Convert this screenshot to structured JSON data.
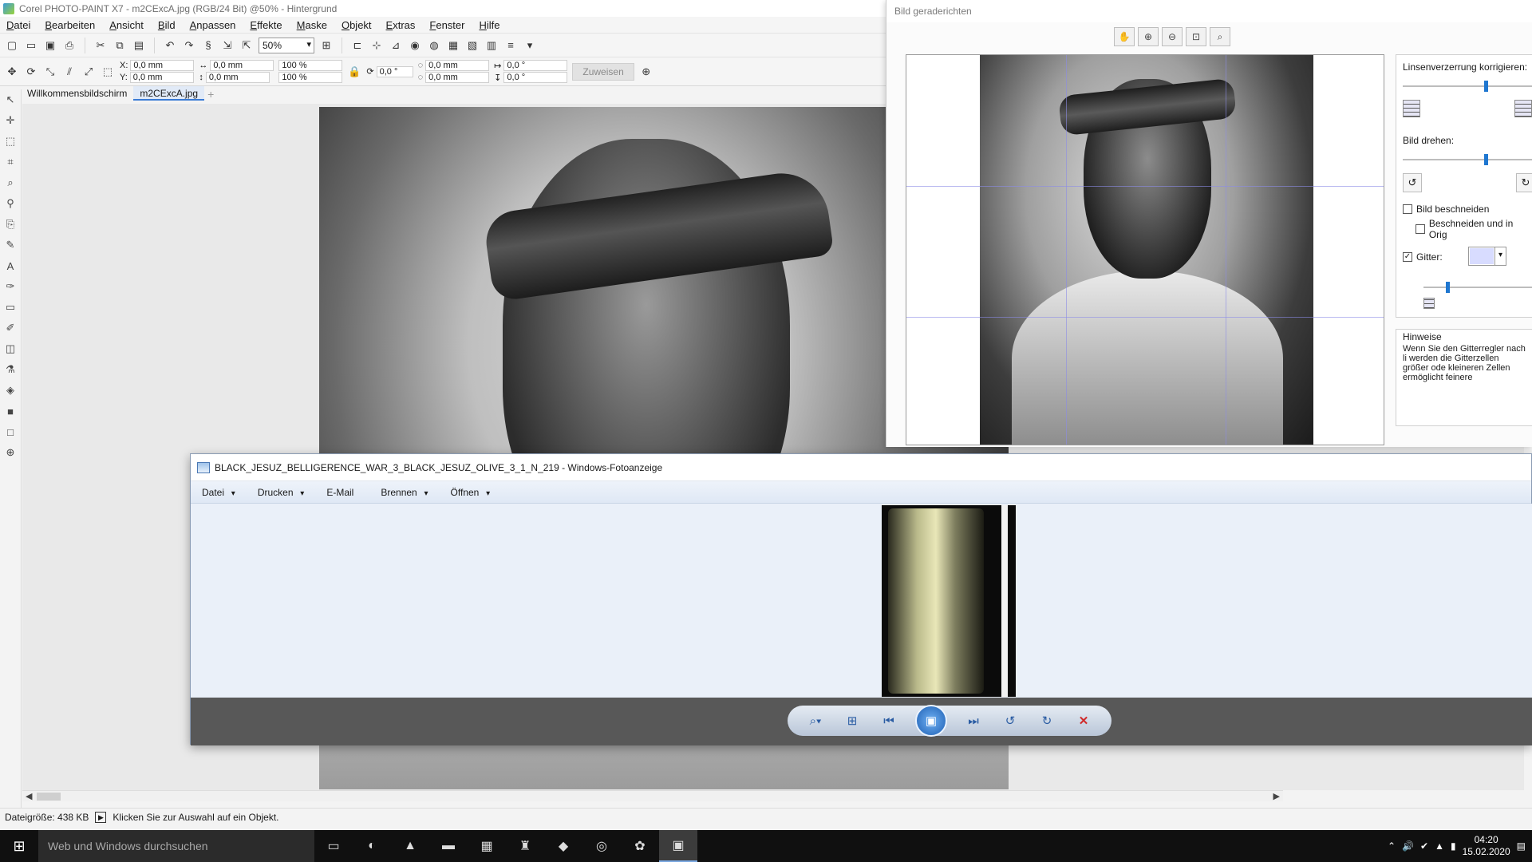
{
  "corel": {
    "title": "Corel PHOTO-PAINT X7 - m2CExcA.jpg (RGB/24 Bit) @50% - Hintergrund",
    "menu": [
      "Datei",
      "Bearbeiten",
      "Ansicht",
      "Bild",
      "Anpassen",
      "Effekte",
      "Maske",
      "Objekt",
      "Extras",
      "Fenster",
      "Hilfe"
    ],
    "zoom": "50%",
    "props": {
      "x": "0,0 mm",
      "y": "0,0 mm",
      "w": "0,0 mm",
      "h": "0,0 mm",
      "scale_w": "100 %",
      "scale_h": "100 %",
      "angle": "0,0 °",
      "pos1": "0,0 mm",
      "pos2": "0,0 mm",
      "skew1": "0,0 °",
      "skew2": "0,0 °",
      "assign": "Zuweisen"
    },
    "tabs": [
      "Willkommensbildschirm",
      "m2CExcA.jpg"
    ],
    "status": {
      "filesize": "Dateigröße: 438 KB",
      "hint": "Klicken Sie zur Auswahl auf ein Objekt."
    }
  },
  "straighten": {
    "title": "Bild geraderichten",
    "lens_label": "Linsenverzerrung korrigieren:",
    "rotate_label": "Bild drehen:",
    "crop_label": "Bild beschneiden",
    "crop_orig_label": "Beschneiden und in Orig",
    "grid_label": "Gitter:",
    "grid_color": "#d8dcff",
    "grid_checked": true,
    "crop_checked": false,
    "lens_value": 0.6,
    "rotate_value": 0.6,
    "gridsize_value": 0.2,
    "hints_title": "Hinweise",
    "hints_text": "Wenn Sie den Gitterregler nach li werden die Gitterzellen größer ode kleineren Zellen ermöglicht feinere"
  },
  "photoviewer": {
    "title": "BLACK_JESUZ_BELLIGERENCE_WAR_3_BLACK_JESUZ_OLIVE_3_1_N_219 - Windows-Fotoanzeige",
    "menu": [
      "Datei",
      "Drucken",
      "E-Mail",
      "Brennen",
      "Öffnen"
    ]
  },
  "taskbar": {
    "search_placeholder": "Web und Windows durchsuchen",
    "time": "04:20",
    "date": "15.02.2020"
  }
}
